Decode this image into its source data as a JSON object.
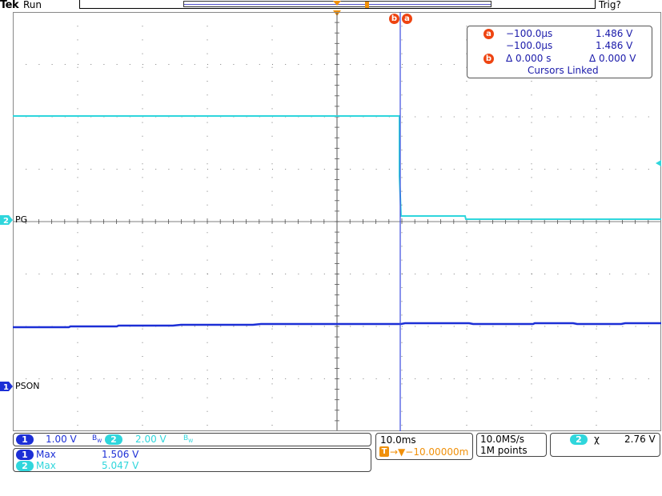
{
  "header": {
    "brand": "Tek",
    "run_state": "Run",
    "trigger_state": "Trig?"
  },
  "colors": {
    "ch1": "#1c2fd6",
    "ch2": "#2fd6dc",
    "cursor": "#ee4411",
    "trigger": "#f0900a",
    "grid": "#555555"
  },
  "channels": {
    "ch1": {
      "number": "1",
      "label": "PSON"
    },
    "ch2": {
      "number": "2",
      "label": "PG"
    }
  },
  "cursor_readout": {
    "a_badge": "a",
    "b_badge": "b",
    "a_time": "−100.0µs",
    "a_value": "1.486 V",
    "b_time": "−100.0µs",
    "b_value": "1.486 V",
    "delta_time": "Δ 0.000 s",
    "delta_value": "Δ 0.000 V",
    "linked": "Cursors Linked"
  },
  "scale_panel": {
    "ch1_scale": "1.00 V",
    "ch2_scale": "2.00 V",
    "bw_symbol": "B",
    "bw_sub": "W"
  },
  "measurements": [
    {
      "channel": "1",
      "name": "Max",
      "value": "1.506 V"
    },
    {
      "channel": "2",
      "name": "Max",
      "value": "5.047 V"
    }
  ],
  "timebase": {
    "time_div": "10.0ms",
    "trigger_position": "→▼−10.00000m"
  },
  "acquisition": {
    "sample_rate": "10.0MS/s",
    "record_length": "1M points"
  },
  "trigger": {
    "channel": "2",
    "slope_symbol": "χ",
    "level": "2.76 V"
  }
}
